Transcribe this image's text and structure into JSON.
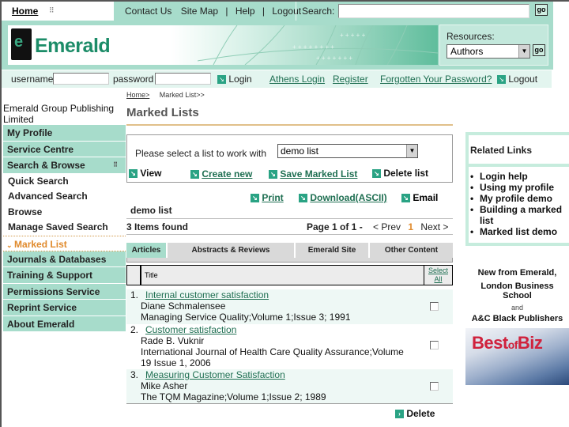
{
  "topnav": {
    "home": "Home",
    "links": [
      "Contact Us",
      "Site Map",
      "Help",
      "Logout"
    ],
    "search_label": "Search:",
    "search_value": "",
    "go_label": "go"
  },
  "banner": {
    "logo_text": "Emerald",
    "resources_label": "Resources:",
    "resources_selected": "Authors",
    "go_label": "go"
  },
  "loginbar": {
    "username_label": "username",
    "password_label": "password",
    "login_label": "Login",
    "athens_login": "Athens Login",
    "register": "Register",
    "forgot_password": "Forgotten Your Password?",
    "logout_label": "Logout"
  },
  "breadcrumb": {
    "home": "Home>",
    "current": "Marked List>>"
  },
  "org_name": "Emerald Group Publishing Limited",
  "page_title": "Marked Lists",
  "sidebar": {
    "items": [
      {
        "label": "My Profile",
        "type": "main"
      },
      {
        "label": "Service Centre",
        "type": "main"
      },
      {
        "label": "Search & Browse",
        "type": "main",
        "expanded": true
      },
      {
        "label": "Quick Search",
        "type": "sub"
      },
      {
        "label": "Advanced Search",
        "type": "sub"
      },
      {
        "label": "Browse",
        "type": "sub"
      },
      {
        "label": "Manage Saved Search",
        "type": "sub"
      },
      {
        "label": "Marked List",
        "type": "active"
      },
      {
        "label": "Journals & Databases",
        "type": "main"
      },
      {
        "label": "Training & Support",
        "type": "main"
      },
      {
        "label": "Permissions Service",
        "type": "main"
      },
      {
        "label": "Reprint Service",
        "type": "main"
      },
      {
        "label": "About Emerald",
        "type": "main"
      }
    ]
  },
  "list_panel": {
    "prompt": "Please select a list to work with",
    "selected_list": "demo list",
    "actions": {
      "view": "View",
      "create_new": "Create new",
      "save_marked_list": "Save Marked List",
      "delete_list": "Delete list"
    }
  },
  "export": {
    "print": "Print",
    "download": "Download(ASCII)",
    "email": "Email"
  },
  "results": {
    "list_name": "demo list",
    "items_found": "3 Items found",
    "page_label": "Page 1 of 1 -",
    "prev": "< Prev",
    "current_page": "1",
    "next": "Next >",
    "tabs": [
      {
        "label": "Articles",
        "active": true
      },
      {
        "label": "Abstracts & Reviews",
        "active": false
      },
      {
        "label": "Emerald Site",
        "active": false
      },
      {
        "label": "Other Content",
        "active": false
      }
    ],
    "header_title": "Title",
    "select_all_1": "Select",
    "select_all_2": "All",
    "rows": [
      {
        "num": "1.",
        "title": "Internal customer satisfaction",
        "author": "Diane Schmalensee",
        "source": "Managing Service Quality;Volume 1;Issue 3; 1991",
        "checked": false
      },
      {
        "num": "2.",
        "title": "Customer satisfaction",
        "author": "Rade B. Vuknir",
        "source": "International Journal of Health Care Quality Assurance;Volume 19 Issue 1, 2006",
        "checked": false
      },
      {
        "num": "3.",
        "title": "Measuring Customer Satisfaction",
        "author": "Mike Asher",
        "source": "The TQM Magazine;Volume 1;Issue 2; 1989",
        "checked": false
      }
    ],
    "delete_label": "Delete"
  },
  "related_links": {
    "heading": "Related Links",
    "items": [
      "Login help",
      "Using my profile",
      "My profile demo",
      "Building a marked list",
      "Marked list demo"
    ]
  },
  "ad": {
    "line1": "New from Emerald,",
    "line2": "London Business School",
    "and": "and",
    "line3": "A&C Black Publishers",
    "brand_1": "Best",
    "brand_2": "of",
    "brand_3": "Biz"
  },
  "colors": {
    "brand_green": "#1c8c68",
    "nav_mint": "#a7dccb",
    "link_green": "#1f6f52",
    "active_orange": "#e08a2c",
    "ad_red": "#d0213c"
  }
}
